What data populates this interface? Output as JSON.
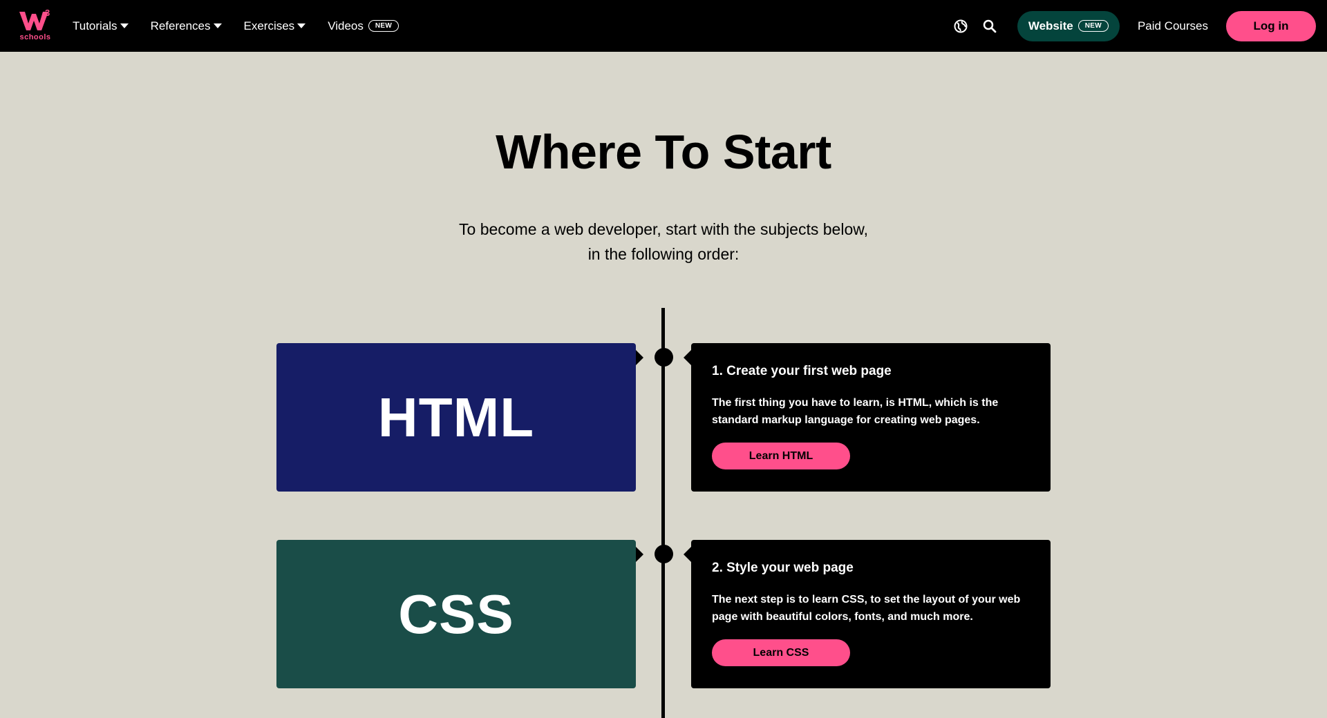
{
  "navbar": {
    "logo_text": "schools",
    "logo_sup": "3",
    "items": [
      {
        "label": "Tutorials"
      },
      {
        "label": "References"
      },
      {
        "label": "Exercises"
      },
      {
        "label": "Videos",
        "badge": "NEW"
      }
    ],
    "website_label": "Website",
    "website_badge": "NEW",
    "paid_courses": "Paid Courses",
    "login": "Log in"
  },
  "hero": {
    "title": "Where To Start",
    "subtitle_line1": "To become a web developer, start with the subjects below,",
    "subtitle_line2": "in the following order:"
  },
  "steps": [
    {
      "subject": "HTML",
      "color": "#161d66",
      "title": "1. Create your first web page",
      "text": "The first thing you have to learn, is HTML, which is the standard markup language for creating web pages.",
      "button": "Learn HTML"
    },
    {
      "subject": "CSS",
      "color": "#1a4d48",
      "title": "2. Style your web page",
      "text": "The next step is to learn CSS, to set the layout of your web page with beautiful colors, fonts, and much more.",
      "button": "Learn CSS"
    }
  ],
  "colors": {
    "accent": "#ff4f8b",
    "navbar": "#000000",
    "background": "#d9d7cc",
    "website_button": "#04443c"
  },
  "icons": {
    "globe": "globe-icon",
    "search": "search-icon"
  }
}
